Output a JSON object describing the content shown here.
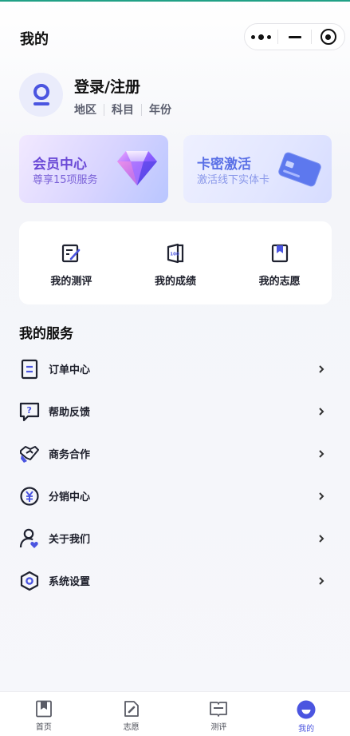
{
  "header": {
    "title": "我的"
  },
  "profile": {
    "login_label": "登录/注册",
    "tags": [
      "地区",
      "科目",
      "年份"
    ]
  },
  "cards": {
    "vip": {
      "title": "会员中心",
      "subtitle": "尊享15项服务",
      "icon": "diamond-icon"
    },
    "key": {
      "title": "卡密激活",
      "subtitle": "激活线下实体卡",
      "icon": "card-icon"
    }
  },
  "quick": [
    {
      "label": "我的测评",
      "icon": "edit-note-icon"
    },
    {
      "label": "我的成绩",
      "icon": "score-door-icon"
    },
    {
      "label": "我的志愿",
      "icon": "bookmark-icon"
    }
  ],
  "services": {
    "title": "我的服务",
    "items": [
      {
        "label": "订单中心",
        "icon": "order-list-icon"
      },
      {
        "label": "帮助反馈",
        "icon": "help-chat-icon"
      },
      {
        "label": "商务合作",
        "icon": "handshake-icon"
      },
      {
        "label": "分销中心",
        "icon": "yen-coin-icon"
      },
      {
        "label": "关于我们",
        "icon": "user-heart-icon"
      },
      {
        "label": "系统设置",
        "icon": "hexagon-settings-icon"
      }
    ]
  },
  "tabbar": [
    {
      "label": "首页",
      "icon": "home-book-icon",
      "active": false
    },
    {
      "label": "志愿",
      "icon": "pen-doc-icon",
      "active": false
    },
    {
      "label": "测评",
      "icon": "test-book-icon",
      "active": false
    },
    {
      "label": "我的",
      "icon": "profile-icon",
      "active": true
    }
  ],
  "colors": {
    "accent": "#4b55e0",
    "vip_title": "#6a49d6",
    "key_title": "#5a70e6",
    "status_strip": "#21a187"
  }
}
